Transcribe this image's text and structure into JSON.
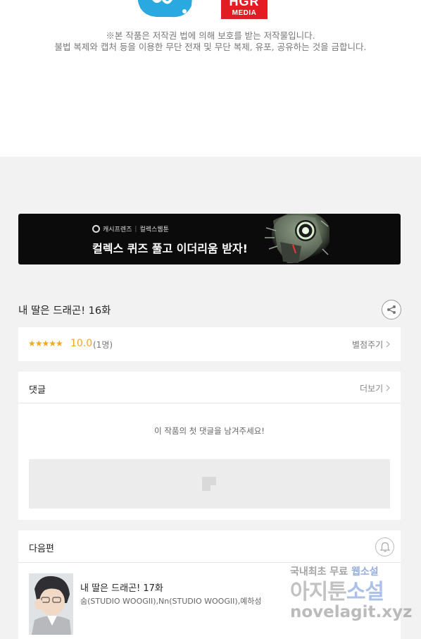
{
  "notice": {
    "logo_right_line1": "HGR",
    "logo_right_line2": "MEDIA",
    "line1": "※본 작품은 저작권 법에 의해 보호를 받는 저작물입니다.",
    "line2": "불법 복제와 캡처 등을 이용한 무단 전재 및 무단 복제, 유포, 공유하는 것을 금합니다."
  },
  "banner": {
    "brand_left": "캐시프렌즈",
    "brand_sep": "|",
    "brand_right": "컬렉스웹툰",
    "headline": "컬렉스 퀴즈 풀고 이더리움 받자!"
  },
  "episode": {
    "title": "내 딸은 드래곤! 16화"
  },
  "rating": {
    "stars": "★★★★★",
    "score": "10.0",
    "count": "(1명)",
    "rate_label": "별점주기",
    "colors": {
      "accent": "#f5a623"
    }
  },
  "comments": {
    "label": "댓글",
    "more_label": "더보기",
    "empty_message": "이 작품의 첫 댓글을 남겨주세요!"
  },
  "next": {
    "label": "다음편",
    "episode_title": "내 딸은 드래곤! 17화",
    "author": "숨(STUDIO WOOGII),Nn(STUDIO WOOGII),예하성"
  },
  "watermark": {
    "line1_a": "국내최초 무료 ",
    "line1_b": "웹소설",
    "line2_a": "아지툰",
    "line2_b": "소설",
    "line3": "novelagit.xyz"
  },
  "icons": [
    "share-icon",
    "chevron-right-icon",
    "bell-icon",
    "image-placeholder-icon"
  ]
}
